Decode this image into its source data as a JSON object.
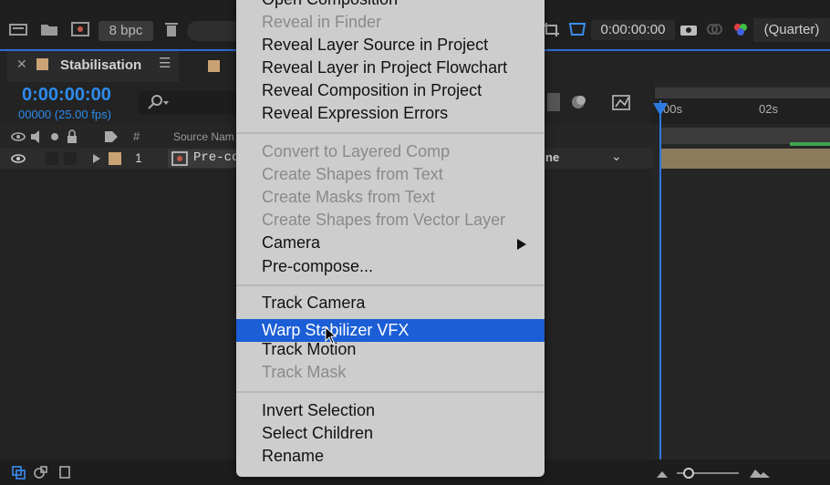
{
  "toolbar": {
    "bpc_label": "8 bpc",
    "timecode": "0:00:00:00",
    "resolution": "(Quarter)"
  },
  "tab": {
    "title": "Stabilisation"
  },
  "time": {
    "current": "0:00:00:00",
    "frames": "00000 (25.00 fps)"
  },
  "columns": {
    "hash": "#",
    "source_name": "Source Nam"
  },
  "layer": {
    "number": "1",
    "name": "Pre-co",
    "mode": "ne"
  },
  "timeline": {
    "tick_0": "00s",
    "tick_2": "02s"
  },
  "context_menu": {
    "items": [
      {
        "label": "Open Composition",
        "enabled": true
      },
      {
        "label": "Reveal in Finder",
        "enabled": false
      },
      {
        "label": "Reveal Layer Source in Project",
        "enabled": true
      },
      {
        "label": "Reveal Layer in Project Flowchart",
        "enabled": true
      },
      {
        "label": "Reveal Composition in Project",
        "enabled": true
      },
      {
        "label": "Reveal Expression Errors",
        "enabled": true
      },
      {
        "label": "Convert to Layered Comp",
        "enabled": false
      },
      {
        "label": "Create Shapes from Text",
        "enabled": false
      },
      {
        "label": "Create Masks from Text",
        "enabled": false
      },
      {
        "label": "Create Shapes from Vector Layer",
        "enabled": false
      },
      {
        "label": "Camera",
        "enabled": true
      },
      {
        "label": "Pre-compose...",
        "enabled": true
      },
      {
        "label": "Track Camera",
        "enabled": true
      },
      {
        "label": "Warp Stabilizer VFX",
        "enabled": true
      },
      {
        "label": "Track Motion",
        "enabled": true
      },
      {
        "label": "Track Mask",
        "enabled": false
      },
      {
        "label": "Invert Selection",
        "enabled": true
      },
      {
        "label": "Select Children",
        "enabled": true
      },
      {
        "label": "Rename",
        "enabled": true
      }
    ],
    "highlighted": "Warp Stabilizer VFX"
  },
  "colors": {
    "accent_blue": "#2d8ceb",
    "menu_highlight": "#1b5ed6",
    "layer_label": "#c9a374"
  }
}
